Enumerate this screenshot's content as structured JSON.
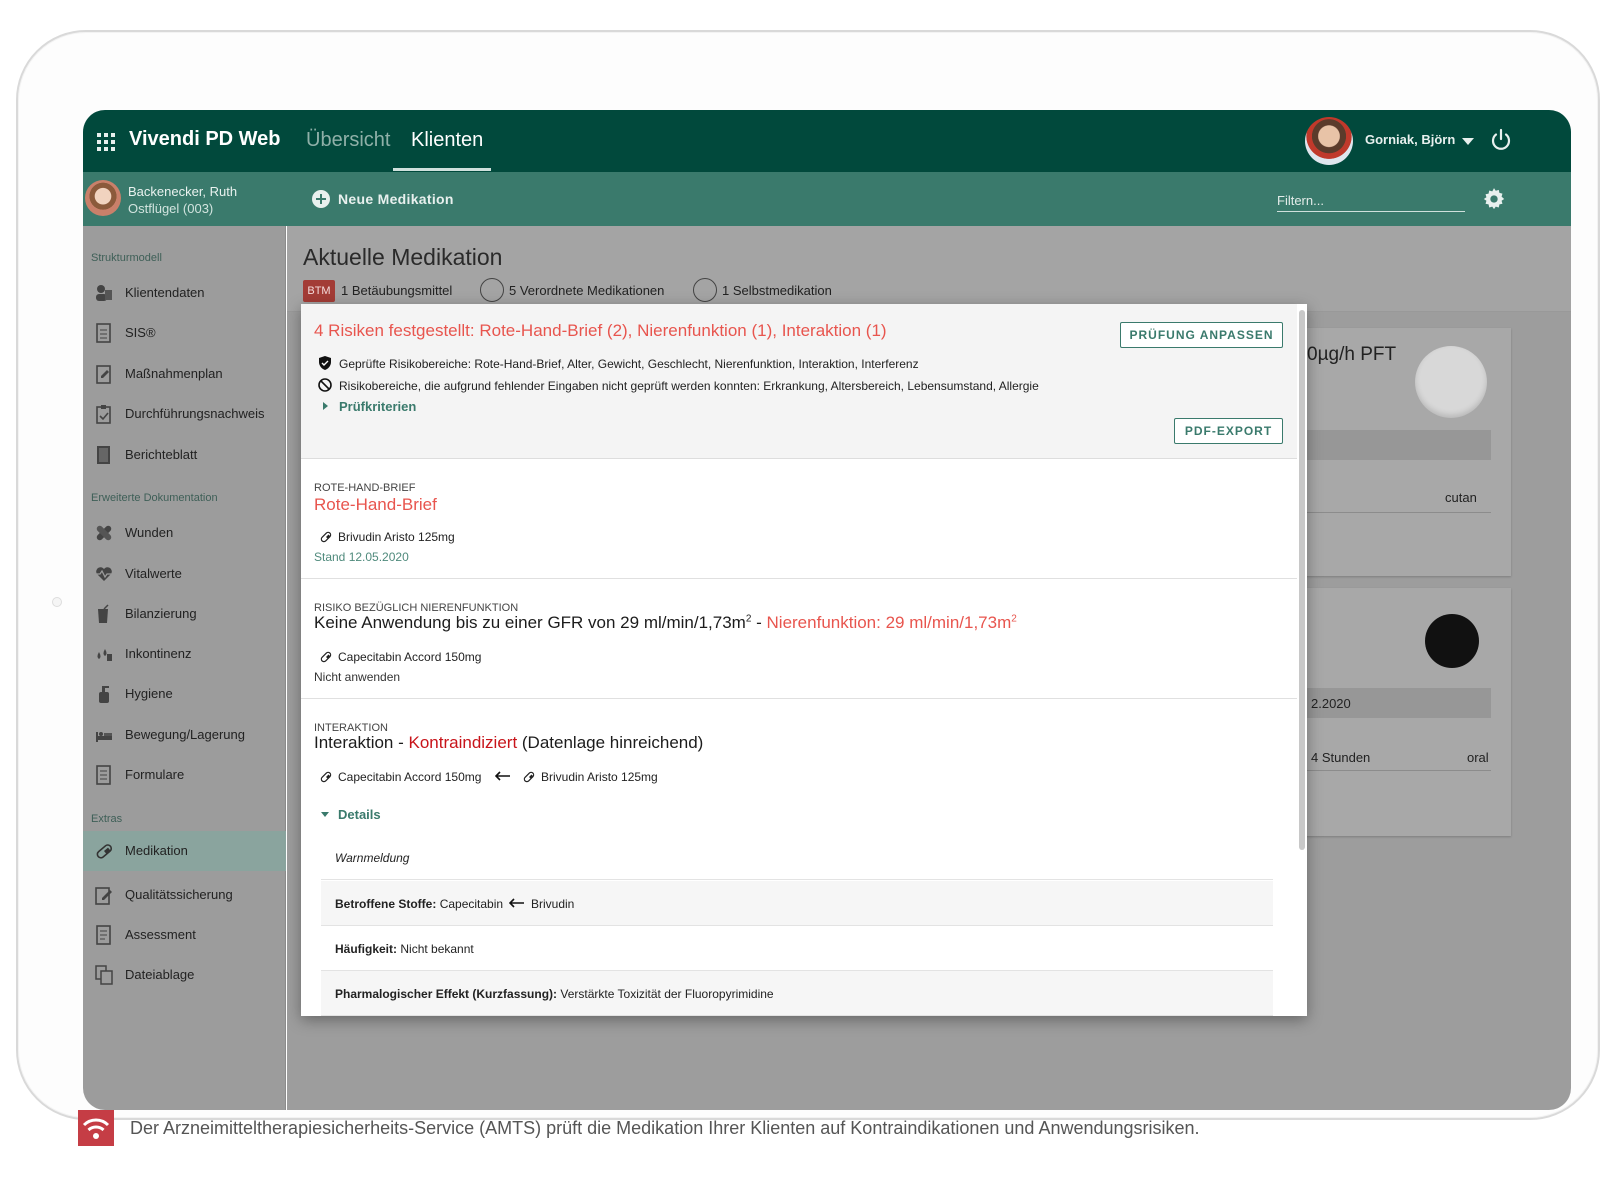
{
  "app": {
    "title": "Vivendi PD Web",
    "tabs": [
      {
        "label": "Übersicht",
        "active": false
      },
      {
        "label": "Klienten",
        "active": true
      }
    ],
    "user": {
      "name": "Gorniak, Björn"
    }
  },
  "patient": {
    "name": "Backenecker, Ruth",
    "unit": "Ostflügel (003)"
  },
  "toolbar": {
    "new_medication": "Neue Medikation",
    "filter_placeholder": "Filtern..."
  },
  "sidebar": {
    "sections": [
      {
        "label": "Strukturmodell",
        "items": [
          "Klientendaten",
          "SIS®",
          "Maßnahmenplan",
          "Durchführungsnachweis",
          "Berichteblatt"
        ]
      },
      {
        "label": "Erweiterte Dokumentation",
        "items": [
          "Wunden",
          "Vitalwerte",
          "Bilanzierung",
          "Inkontinenz",
          "Hygiene",
          "Bewegung/Lagerung",
          "Formulare"
        ]
      },
      {
        "label": "Extras",
        "items": [
          "Medikation",
          "Qualitätssicherung",
          "Assessment",
          "Dateiablage"
        ]
      }
    ],
    "active_item": "Medikation"
  },
  "main": {
    "title": "Aktuelle Medikation",
    "summary": {
      "btm_badge": "BTM",
      "btm": "1 Betäubungsmittel",
      "prescribed": "5 Verordnete Medikationen",
      "self": "1 Selbstmedikation"
    },
    "background": {
      "card1_title": "0µg/h PFT",
      "card1_route": "cutan",
      "card2_date": "2.2020",
      "card2_interval": "4 Stunden",
      "card2_route": "oral"
    }
  },
  "modal": {
    "risk_title": "4 Risiken festgestellt: Rote-Hand-Brief (2), Nierenfunktion (1), Interaktion (1)",
    "btn_adjust": "PRÜFUNG ANPASSEN",
    "btn_pdf": "PDF-EXPORT",
    "checked_areas": "Geprüfte Risikobereiche: Rote-Hand-Brief, Alter, Gewicht, Geschlecht, Nierenfunktion, Interaktion, Interferenz",
    "unchecked_areas": "Risikobereiche, die aufgrund fehlender Eingaben nicht geprüft werden konnten: Erkrankung, Altersbereich, Lebensumstand, Allergie",
    "criteria_label": "Prüfkriterien",
    "sec1": {
      "category": "ROTE-HAND-BRIEF",
      "title": "Rote-Hand-Brief",
      "drug": "Brivudin Aristo 125mg",
      "stand": "Stand 12.05.2020"
    },
    "sec2": {
      "category": "RISIKO BEZÜGLICH NIERENFUNKTION",
      "title_main": "Keine Anwendung bis zu einer GFR von 29 ml/min/1,73m",
      "title_sup": "2",
      "title_sep": " - ",
      "title_red": "Nierenfunktion: 29 ml/min/1,73m",
      "title_red_sup": "2",
      "drug": "Capecitabin Accord 150mg",
      "note": "Nicht anwenden"
    },
    "sec3": {
      "category": "INTERAKTION",
      "title_main": "Interaktion - ",
      "title_red": "Kontraindiziert",
      "title_tail": " (Datenlage hinreichend)",
      "drug_a": "Capecitabin Accord 150mg",
      "drug_b": "Brivudin Aristo 125mg",
      "details_label": "Details",
      "rows": [
        {
          "label": "",
          "value": "Warnmeldung"
        },
        {
          "label": "Betroffene Stoffe:",
          "value": "Capecitabin",
          "value2": "Brivudin"
        },
        {
          "label": "Häufigkeit:",
          "value": "Nicht bekannt"
        },
        {
          "label": "Pharmalogischer Effekt (Kurzfassung):",
          "value": "Verstärkte Toxizität der Fluoropyrimidine"
        }
      ]
    }
  },
  "footer": {
    "caption": "Der Arzneimitteltherapiesicherheits-Service (AMTS) prüft die Medikation Ihrer Klienten auf Kontraindikationen und Anwendungsrisiken."
  },
  "colors": {
    "brand_dark": "#01493c",
    "brand": "#3a7a6c",
    "risk_red": "#e8554e",
    "contra_red": "#c8141a",
    "footer_accent": "#c53d45"
  }
}
